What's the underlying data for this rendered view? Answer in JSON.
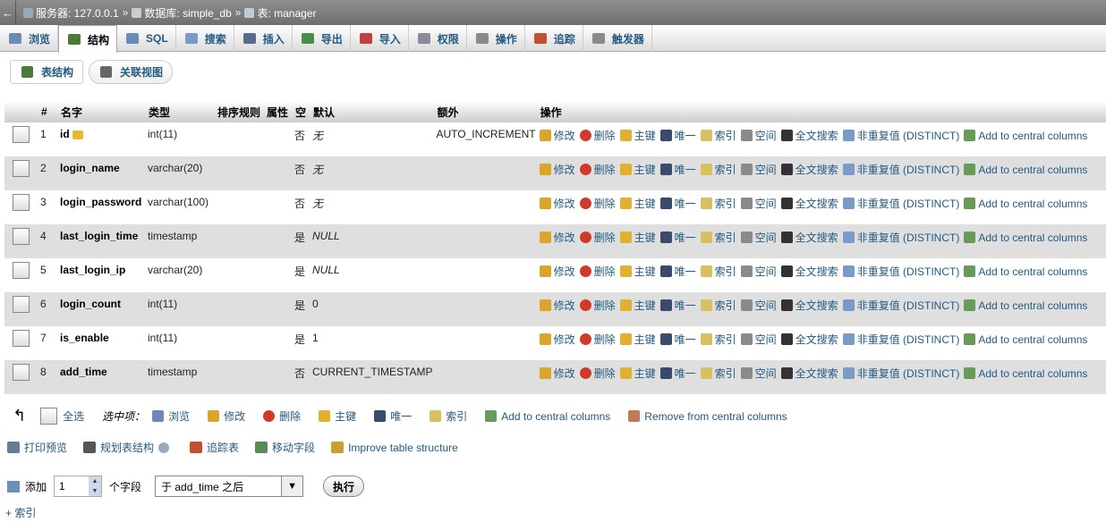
{
  "breadcrumb": {
    "back": "←",
    "server": "服务器: 127.0.0.1",
    "database": "数据库: simple_db",
    "table": "表: manager",
    "sep": "»"
  },
  "tabs": [
    {
      "label": "浏览",
      "icon": "browse-icon",
      "color": "#6a8ab8"
    },
    {
      "label": "结构",
      "icon": "structure-icon",
      "color": "#4b7a3b"
    },
    {
      "label": "SQL",
      "icon": "sql-icon",
      "color": "#6a8ab8"
    },
    {
      "label": "搜索",
      "icon": "search-icon",
      "color": "#7a9ac8"
    },
    {
      "label": "插入",
      "icon": "insert-icon",
      "color": "#5a6a8a"
    },
    {
      "label": "导出",
      "icon": "export-icon",
      "color": "#4a8a4a"
    },
    {
      "label": "导入",
      "icon": "import-icon",
      "color": "#c04040"
    },
    {
      "label": "权限",
      "icon": "privileges-icon",
      "color": "#8a8a9a"
    },
    {
      "label": "操作",
      "icon": "wrench-icon",
      "color": "#8a8a8a"
    },
    {
      "label": "追踪",
      "icon": "eye-icon",
      "color": "#c05030"
    },
    {
      "label": "触发器",
      "icon": "triggers-icon",
      "color": "#8a8a8a"
    }
  ],
  "subtabs": [
    {
      "label": "表结构",
      "color": "#4b7a3b"
    },
    {
      "label": "关联视图",
      "color": "#666"
    }
  ],
  "table": {
    "headers": [
      "#",
      "名字",
      "类型",
      "排序规则",
      "属性",
      "空",
      "默认",
      "额外",
      "操作"
    ],
    "rows": [
      {
        "num": "1",
        "name": "id",
        "type": "int(11)",
        "collation": "",
        "attr": "",
        "null": "否",
        "default": "无",
        "default_italic": true,
        "extra": "AUTO_INCREMENT",
        "key": true
      },
      {
        "num": "2",
        "name": "login_name",
        "type": "varchar(20)",
        "collation": "",
        "attr": "",
        "null": "否",
        "default": "无",
        "default_italic": true,
        "extra": "",
        "key": false
      },
      {
        "num": "3",
        "name": "login_password",
        "type": "varchar(100)",
        "collation": "",
        "attr": "",
        "null": "否",
        "default": "无",
        "default_italic": true,
        "extra": "",
        "key": false
      },
      {
        "num": "4",
        "name": "last_login_time",
        "type": "timestamp",
        "collation": "",
        "attr": "",
        "null": "是",
        "default": "NULL",
        "default_italic": true,
        "extra": "",
        "key": false
      },
      {
        "num": "5",
        "name": "last_login_ip",
        "type": "varchar(20)",
        "collation": "",
        "attr": "",
        "null": "是",
        "default": "NULL",
        "default_italic": true,
        "extra": "",
        "key": false
      },
      {
        "num": "6",
        "name": "login_count",
        "type": "int(11)",
        "collation": "",
        "attr": "",
        "null": "是",
        "default": "0",
        "default_italic": false,
        "extra": "",
        "key": false
      },
      {
        "num": "7",
        "name": "is_enable",
        "type": "int(11)",
        "collation": "",
        "attr": "",
        "null": "是",
        "default": "1",
        "default_italic": false,
        "extra": "",
        "key": false
      },
      {
        "num": "8",
        "name": "add_time",
        "type": "timestamp",
        "collation": "",
        "attr": "",
        "null": "否",
        "default": "CURRENT_TIMESTAMP",
        "default_italic": false,
        "extra": "",
        "key": false
      }
    ],
    "actions": [
      {
        "label": "修改",
        "icon": "pencil-icon",
        "color": "#d9a52a"
      },
      {
        "label": "删除",
        "icon": "delete-icon",
        "color": "#d03a2a"
      },
      {
        "label": "主键",
        "icon": "key-icon",
        "color": "#e0b030"
      },
      {
        "label": "唯一",
        "icon": "unique-icon",
        "color": "#3a4a6a"
      },
      {
        "label": "索引",
        "icon": "index-icon",
        "color": "#d8c060"
      },
      {
        "label": "空间",
        "icon": "spatial-icon",
        "color": "#8a8a8a"
      },
      {
        "label": "全文搜索",
        "icon": "fulltext-icon",
        "color": "#333"
      },
      {
        "label": "非重复值 (DISTINCT)",
        "icon": "distinct-icon",
        "color": "#7a9ac8"
      },
      {
        "label": "Add to central columns",
        "icon": "central-add-icon",
        "color": "#6a9a5a"
      }
    ]
  },
  "bulk": {
    "arrow": "↰",
    "check_all": "全选",
    "with_selected": "选中项：",
    "items": [
      {
        "label": "浏览",
        "icon": "browse-icon",
        "color": "#6a8ab8"
      },
      {
        "label": "修改",
        "icon": "pencil-icon",
        "color": "#d9a52a"
      },
      {
        "label": "删除",
        "icon": "delete-icon",
        "color": "#d03a2a"
      },
      {
        "label": "主键",
        "icon": "key-icon",
        "color": "#e0b030"
      },
      {
        "label": "唯一",
        "icon": "unique-icon",
        "color": "#3a4a6a"
      },
      {
        "label": "索引",
        "icon": "index-icon",
        "color": "#d8c060"
      },
      {
        "label": "Add to central columns",
        "icon": "central-add-icon",
        "color": "#6a9a5a"
      },
      {
        "label": "Remove from central columns",
        "icon": "central-remove-icon",
        "color": "#c07a5a"
      }
    ]
  },
  "links": [
    {
      "label": "打印预览",
      "icon": "print-icon",
      "color": "#6a7a9a"
    },
    {
      "label": "规划表结构",
      "icon": "propose-icon",
      "color": "#555"
    },
    {
      "label": "追踪表",
      "icon": "eye-icon",
      "color": "#c05030"
    },
    {
      "label": "移动字段",
      "icon": "move-icon",
      "color": "#5a8a5a"
    },
    {
      "label": "Improve table structure",
      "icon": "wand-icon",
      "color": "#c8a030"
    }
  ],
  "add": {
    "label": "添加",
    "count": "1",
    "unit": "个字段",
    "position": "于 add_time 之后",
    "go": "执行"
  },
  "index_link": "+ 索引"
}
